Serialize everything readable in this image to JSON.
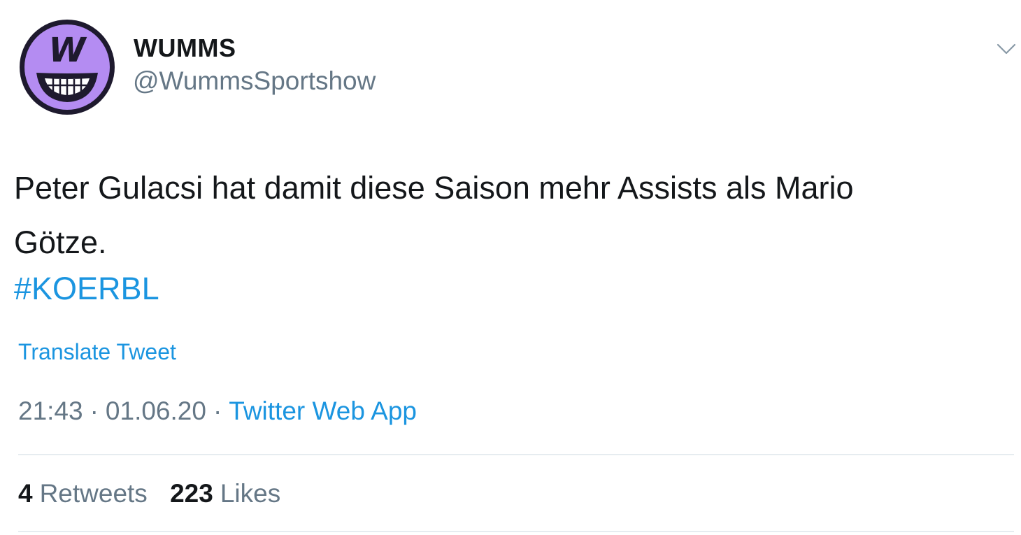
{
  "author": {
    "display_name": "WUMMS",
    "handle": "@WummsSportshow",
    "avatar_icon": "wumms-grin-logo",
    "avatar_letter": "W",
    "avatar_color": "#b48cf2"
  },
  "tweet": {
    "text_lines": [
      "Peter Gulacsi hat damit diese Saison mehr Assists als Mario",
      "Götze."
    ],
    "hashtag": "#KOERBL",
    "translate_label": "Translate Tweet"
  },
  "meta": {
    "time": "21:43",
    "date": "01.06.20",
    "separator": "·",
    "source": "Twitter Web App"
  },
  "stats": {
    "retweets_count": "4",
    "retweets_label": "Retweets",
    "likes_count": "223",
    "likes_label": "Likes"
  },
  "colors": {
    "link": "#1b95e0",
    "secondary_text": "#657786",
    "primary_text": "#14171a",
    "divider": "#e6ecf0"
  },
  "icons": {
    "menu": "chevron-down-icon"
  }
}
